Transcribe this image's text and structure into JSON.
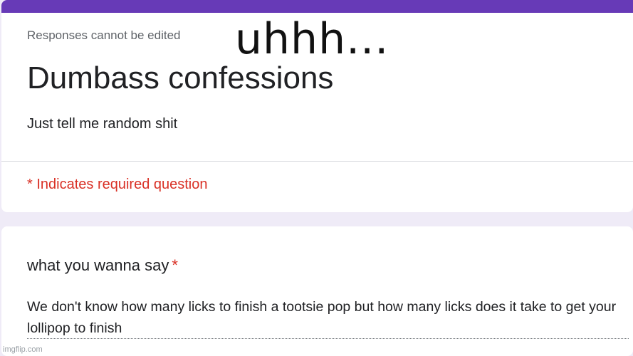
{
  "colors": {
    "accent": "#673ab7",
    "required": "#d93025",
    "background": "#efebf7"
  },
  "header": {
    "responses_note": "Responses cannot be edited",
    "title": "Dumbass confessions",
    "description": "Just tell me random shit",
    "required_note": "* Indicates required question"
  },
  "overlay": {
    "caption": "uhhh..."
  },
  "question": {
    "title": "what you wanna say",
    "required_marker": "*",
    "answer": "We don't know how many licks to finish a tootsie pop but how many licks does it take to get your lollipop to finish"
  },
  "watermark": {
    "text": "imgflip.com"
  }
}
